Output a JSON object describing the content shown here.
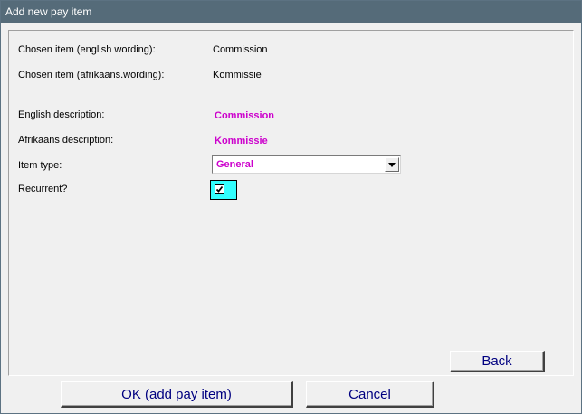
{
  "window": {
    "title": "Add new pay item"
  },
  "form": {
    "chosen_english_label": "Chosen item (english wording):",
    "chosen_english_value": "Commission",
    "chosen_afrikaans_label": "Chosen item (afrikaans.wording):",
    "chosen_afrikaans_value": "Kommissie",
    "english_description_label": "English description:",
    "english_description_value": "Commission",
    "afrikaans_description_label": "Afrikaans description:",
    "afrikaans_description_value": "Kommissie",
    "item_type_label": "Item type:",
    "item_type_value": "General",
    "recurrent_label": "Recurrent?",
    "recurrent_checked": true
  },
  "buttons": {
    "back_label": "Back",
    "ok_mnemonic": "O",
    "ok_rest": "K (add pay item)",
    "cancel_mnemonic": "C",
    "cancel_rest": "ancel"
  },
  "colors": {
    "accent_text": "#cc00cc",
    "checkbox_bg": "#33ffff",
    "button_text": "#000080",
    "titlebar_bg": "#556b79"
  }
}
